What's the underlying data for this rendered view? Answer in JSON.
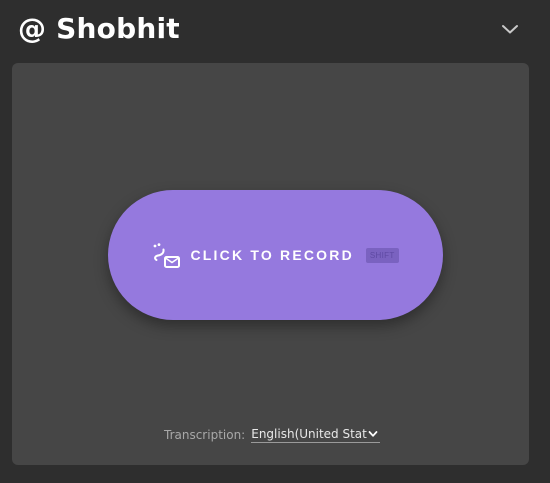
{
  "header": {
    "title": "@ Shobhit",
    "collapse_icon": "chevron-down-icon"
  },
  "record": {
    "label": "CLICK TO RECORD",
    "shortcut": "SHIFT",
    "icon": "voice-message-icon",
    "accent_color": "#9579de"
  },
  "transcription": {
    "label": "Transcription:",
    "selected_language": "English(United States)"
  },
  "colors": {
    "background": "#2e2e2e",
    "panel": "#464646"
  }
}
